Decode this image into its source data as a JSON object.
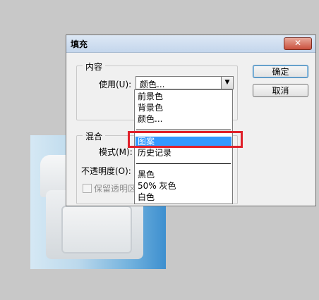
{
  "dialog": {
    "title": "填充",
    "close_icon": "close-icon",
    "ok_label": "确定",
    "cancel_label": "取消"
  },
  "contents": {
    "legend": "内容",
    "use_label": "使用(U):",
    "use_value": "颜色..."
  },
  "blending": {
    "legend": "混合",
    "mode_label": "模式(M):",
    "opacity_label": "不透明度(O):",
    "preserve_label": "保留透明区"
  },
  "dropdown": {
    "items": [
      "前景色",
      "背景色",
      "颜色...",
      "图案",
      "历史记录",
      "黑色",
      "50% 灰色",
      "白色"
    ],
    "selected": "图案"
  },
  "colors": {
    "highlight_box": "#e0202a",
    "selection": "#3399ff"
  }
}
